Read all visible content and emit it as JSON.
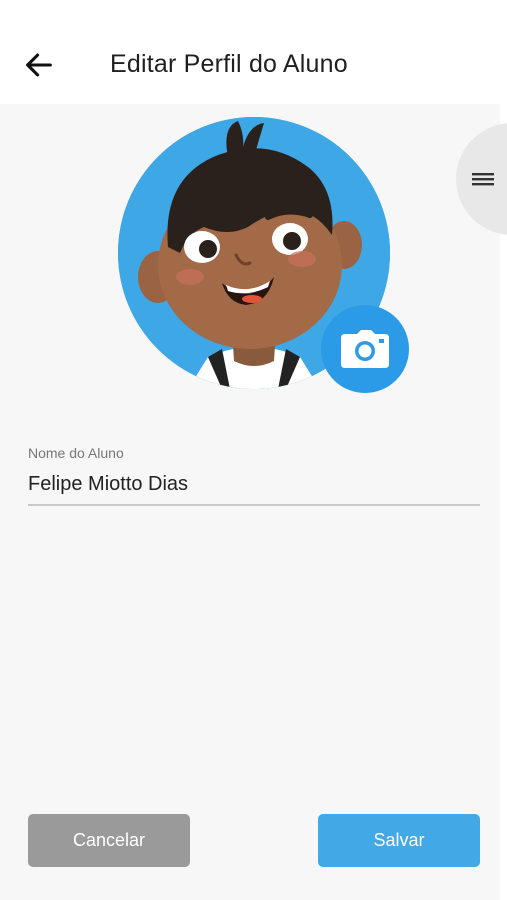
{
  "header": {
    "title": "Editar Perfil do Aluno",
    "back_icon": "arrow-left-icon"
  },
  "drawer": {
    "icon": "menu-icon"
  },
  "avatar": {
    "icon": "camera-icon",
    "accent": "#2b9be8"
  },
  "form": {
    "name_label": "Nome do Aluno",
    "name_value": "Felipe Miotto Dias"
  },
  "actions": {
    "cancel_label": "Cancelar",
    "save_label": "Salvar",
    "cancel_color": "#9a9a9a",
    "save_color": "#42a8e6"
  }
}
